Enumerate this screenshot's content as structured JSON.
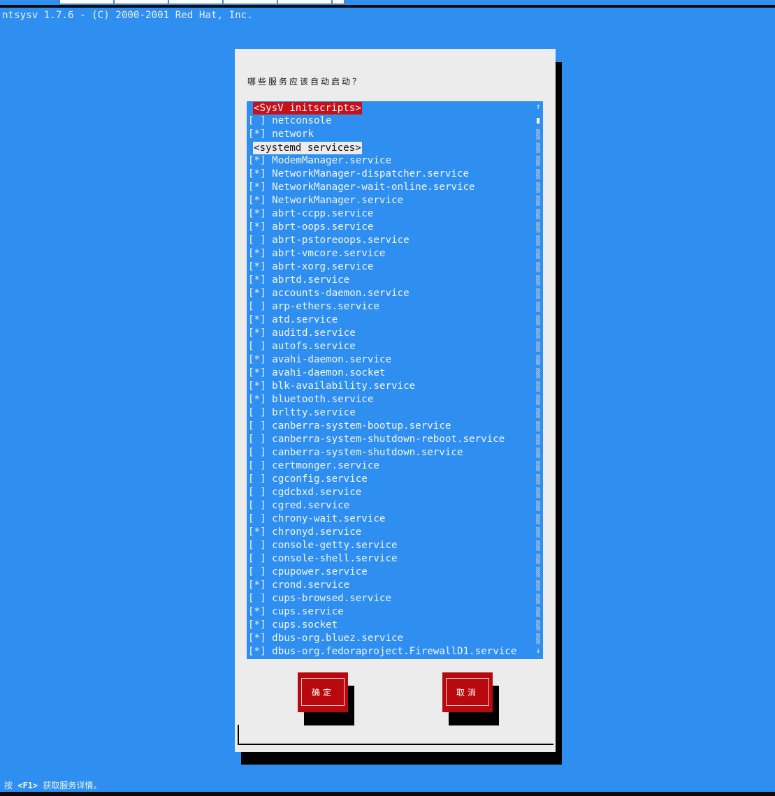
{
  "header": {
    "title": "ntsysv 1.7.6 - (C) 2000-2001 Red Hat, Inc."
  },
  "dialog": {
    "prompt": "哪些服务应该自动启动？",
    "ok_label": "确定",
    "cancel_label": "取消"
  },
  "services": [
    {
      "type": "section",
      "label": "<SysV initscripts>",
      "active": true
    },
    {
      "type": "item",
      "check": "[ ]",
      "name": "netconsole"
    },
    {
      "type": "item",
      "check": "[*]",
      "name": "network"
    },
    {
      "type": "section",
      "label": "<systemd services>",
      "active": false
    },
    {
      "type": "item",
      "check": "[*]",
      "name": "ModemManager.service"
    },
    {
      "type": "item",
      "check": "[*]",
      "name": "NetworkManager-dispatcher.service"
    },
    {
      "type": "item",
      "check": "[*]",
      "name": "NetworkManager-wait-online.service"
    },
    {
      "type": "item",
      "check": "[*]",
      "name": "NetworkManager.service"
    },
    {
      "type": "item",
      "check": "[*]",
      "name": "abrt-ccpp.service"
    },
    {
      "type": "item",
      "check": "[*]",
      "name": "abrt-oops.service"
    },
    {
      "type": "item",
      "check": "[ ]",
      "name": "abrt-pstoreoops.service"
    },
    {
      "type": "item",
      "check": "[*]",
      "name": "abrt-vmcore.service"
    },
    {
      "type": "item",
      "check": "[*]",
      "name": "abrt-xorg.service"
    },
    {
      "type": "item",
      "check": "[*]",
      "name": "abrtd.service"
    },
    {
      "type": "item",
      "check": "[*]",
      "name": "accounts-daemon.service"
    },
    {
      "type": "item",
      "check": "[ ]",
      "name": "arp-ethers.service"
    },
    {
      "type": "item",
      "check": "[*]",
      "name": "atd.service"
    },
    {
      "type": "item",
      "check": "[*]",
      "name": "auditd.service"
    },
    {
      "type": "item",
      "check": "[ ]",
      "name": "autofs.service"
    },
    {
      "type": "item",
      "check": "[*]",
      "name": "avahi-daemon.service"
    },
    {
      "type": "item",
      "check": "[*]",
      "name": "avahi-daemon.socket"
    },
    {
      "type": "item",
      "check": "[*]",
      "name": "blk-availability.service"
    },
    {
      "type": "item",
      "check": "[*]",
      "name": "bluetooth.service"
    },
    {
      "type": "item",
      "check": "[ ]",
      "name": "brltty.service"
    },
    {
      "type": "item",
      "check": "[ ]",
      "name": "canberra-system-bootup.service"
    },
    {
      "type": "item",
      "check": "[ ]",
      "name": "canberra-system-shutdown-reboot.service"
    },
    {
      "type": "item",
      "check": "[ ]",
      "name": "canberra-system-shutdown.service"
    },
    {
      "type": "item",
      "check": "[ ]",
      "name": "certmonger.service"
    },
    {
      "type": "item",
      "check": "[ ]",
      "name": "cgconfig.service"
    },
    {
      "type": "item",
      "check": "[ ]",
      "name": "cgdcbxd.service"
    },
    {
      "type": "item",
      "check": "[ ]",
      "name": "cgred.service"
    },
    {
      "type": "item",
      "check": "[ ]",
      "name": "chrony-wait.service"
    },
    {
      "type": "item",
      "check": "[*]",
      "name": "chronyd.service"
    },
    {
      "type": "item",
      "check": "[ ]",
      "name": "console-getty.service"
    },
    {
      "type": "item",
      "check": "[ ]",
      "name": "console-shell.service"
    },
    {
      "type": "item",
      "check": "[ ]",
      "name": "cpupower.service"
    },
    {
      "type": "item",
      "check": "[*]",
      "name": "crond.service"
    },
    {
      "type": "item",
      "check": "[ ]",
      "name": "cups-browsed.service"
    },
    {
      "type": "item",
      "check": "[*]",
      "name": "cups.service"
    },
    {
      "type": "item",
      "check": "[*]",
      "name": "cups.socket"
    },
    {
      "type": "item",
      "check": "[*]",
      "name": "dbus-org.bluez.service"
    },
    {
      "type": "item",
      "check": "[*]",
      "name": "dbus-org.fedoraproject.FirewallD1.service"
    }
  ],
  "footer": {
    "prefix": "按 ",
    "key": "<F1>",
    "suffix": " 获取服务详情。"
  },
  "colors": {
    "background": "#2f8ff0",
    "dialog": "#ececec",
    "button": "#b8090f",
    "highlight": "#c8101a"
  }
}
